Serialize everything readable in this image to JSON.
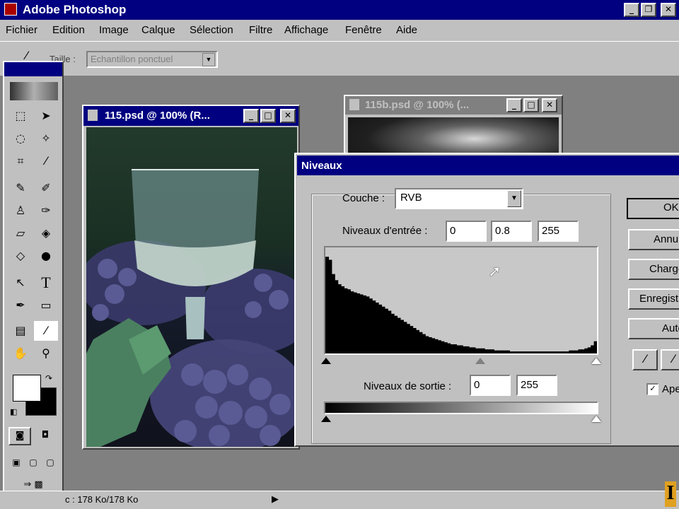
{
  "app": {
    "title": "Adobe Photoshop",
    "colors": {
      "titlebar": "#000080",
      "chrome": "#c0c0c0",
      "desktop": "#808080"
    }
  },
  "menu": [
    "Fichier",
    "Edition",
    "Image",
    "Calque",
    "Sélection",
    "Filtre",
    "Affichage",
    "Fenêtre",
    "Aide"
  ],
  "options": {
    "taille_label": "Taille :",
    "taille_value": "Echantillon ponctuel"
  },
  "tools": {
    "icons": [
      "marquee-icon",
      "move-icon",
      "lasso-icon",
      "magic-wand-icon",
      "crop-icon",
      "eyedropper-icon",
      "airbrush-icon",
      "brush-icon",
      "stamp-icon",
      "history-brush-icon",
      "eraser-icon",
      "bucket-icon",
      "blur-icon",
      "burn-icon",
      "pen-icon",
      "text-icon",
      "path-select-icon",
      "rectangle-icon",
      "notes-icon",
      "eyedropper-icon",
      "hand-icon",
      "zoom-icon"
    ],
    "text_tool_label": "T"
  },
  "doc1": {
    "title": "115.psd @ 100% (R..."
  },
  "doc2": {
    "title": "115b.psd @ 100% (..."
  },
  "levels": {
    "title": "Niveaux",
    "channel_label": "Couche :",
    "channel_value": "RVB",
    "input_label": "Niveaux d'entrée :",
    "input_black": "0",
    "input_gamma": "0.8",
    "input_white": "255",
    "output_label": "Niveaux de sortie :",
    "output_black": "0",
    "output_white": "255",
    "buttons": {
      "ok": "OK",
      "cancel": "Annuler",
      "load": "Charger...",
      "save": "Enregistrer...",
      "auto": "Auto"
    },
    "preview_label": "Aperçu",
    "preview_checked": true,
    "histogram": [
      95,
      92,
      78,
      72,
      68,
      66,
      64,
      63,
      61,
      60,
      59,
      58,
      57,
      56,
      54,
      52,
      50,
      48,
      46,
      44,
      42,
      39,
      37,
      35,
      33,
      31,
      29,
      27,
      25,
      23,
      21,
      19,
      17,
      16,
      15,
      14,
      13,
      12,
      11,
      10,
      9,
      9,
      8,
      8,
      7,
      7,
      6,
      6,
      5,
      5,
      5,
      4,
      4,
      4,
      3,
      3,
      3,
      3,
      3,
      2,
      2,
      2,
      2,
      2,
      2,
      2,
      2,
      2,
      2,
      2,
      2,
      2,
      2,
      2,
      2,
      2,
      2,
      2,
      3,
      3,
      3,
      4,
      4,
      5,
      6,
      8,
      12
    ]
  },
  "status": {
    "doc_size": "c : 178 Ko/178 Ko"
  }
}
